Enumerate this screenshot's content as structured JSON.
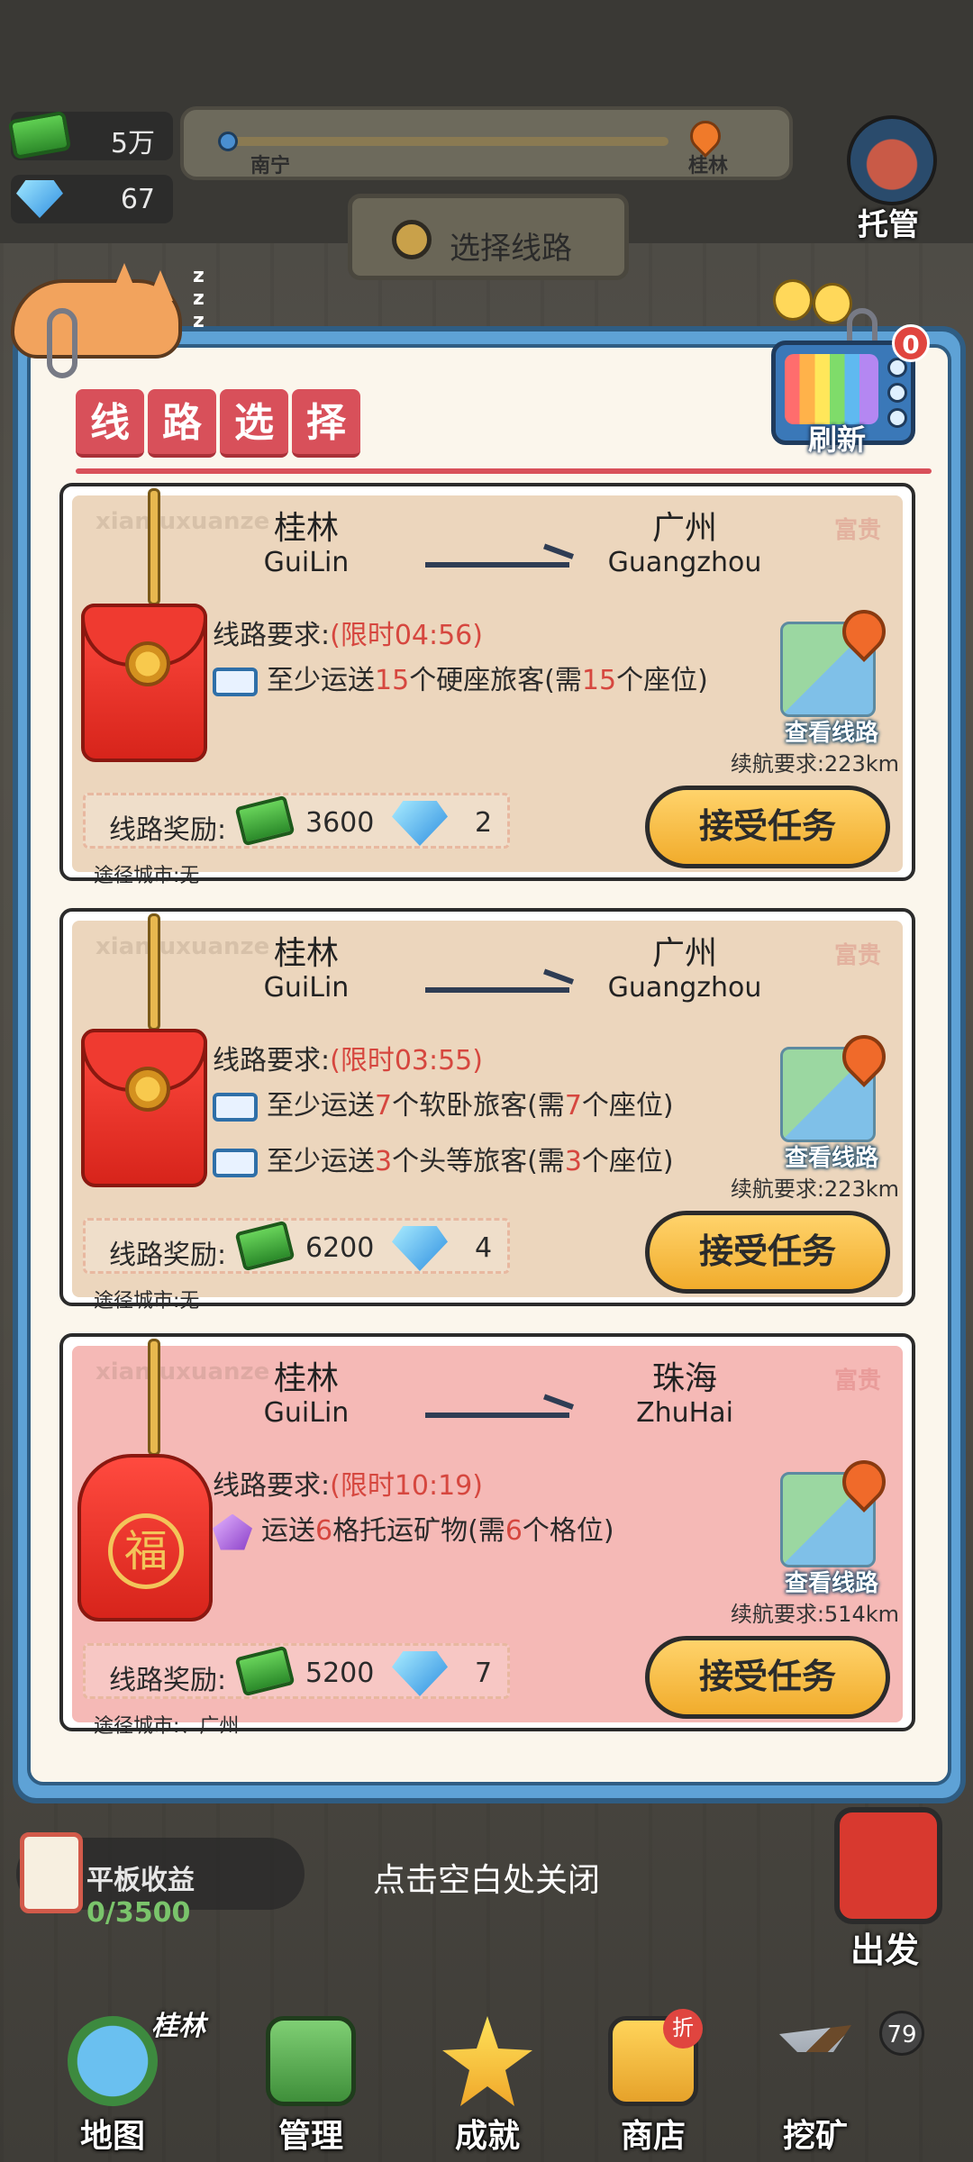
{
  "hud": {
    "money": "5万",
    "gems": "67",
    "route_from": "南宁",
    "route_to": "桂林",
    "select_route_button": "选择线路",
    "autopilot_label": "托管"
  },
  "dialog": {
    "title_chars": [
      "线",
      "路",
      "选",
      "择"
    ],
    "refresh_label": "刷新",
    "refresh_count": "0",
    "watermark": "xianluxuanze",
    "stamp": "富贵"
  },
  "cards": [
    {
      "from_zh": "桂林",
      "from_en": "GuiLin",
      "to_zh": "广州",
      "to_en": "Guangzhou",
      "req_label": "线路要求:",
      "time_limit": "(限时04:56)",
      "requirements": [
        {
          "pre": "至少运送",
          "n1": "15",
          "mid": "个硬座旅客(需",
          "n2": "15",
          "post": "个座位)"
        }
      ],
      "map_button": "查看线路",
      "range": "续航要求:223km",
      "reward_label": "线路奖励:",
      "reward_cash": "3600",
      "reward_gems": "2",
      "via": "途径城市:无",
      "accept": "接受任务"
    },
    {
      "from_zh": "桂林",
      "from_en": "GuiLin",
      "to_zh": "广州",
      "to_en": "Guangzhou",
      "req_label": "线路要求:",
      "time_limit": "(限时03:55)",
      "requirements": [
        {
          "pre": "至少运送",
          "n1": "7",
          "mid": "个软卧旅客(需",
          "n2": "7",
          "post": "个座位)"
        },
        {
          "pre": "至少运送",
          "n1": "3",
          "mid": "个头等旅客(需",
          "n2": "3",
          "post": "个座位)"
        }
      ],
      "map_button": "查看线路",
      "range": "续航要求:223km",
      "reward_label": "线路奖励:",
      "reward_cash": "6200",
      "reward_gems": "4",
      "via": "途径城市:无",
      "accept": "接受任务"
    },
    {
      "from_zh": "桂林",
      "from_en": "GuiLin",
      "to_zh": "珠海",
      "to_en": "ZhuHai",
      "req_label": "线路要求:",
      "time_limit": "(限时10:19)",
      "requirements": [
        {
          "pre": "运送",
          "n1": "6",
          "mid": "格托运矿物(需",
          "n2": "6",
          "post": "个格位)"
        }
      ],
      "map_button": "查看线路",
      "range": "续航要求:514km",
      "reward_label": "线路奖励:",
      "reward_cash": "5200",
      "reward_gems": "7",
      "via": "途径城市:、广州",
      "accept": "接受任务",
      "fu_char": "福"
    }
  ],
  "bottom": {
    "close_hint": "点击空白处关闭",
    "tablet_label": "平板收益",
    "tablet_value": "0/3500",
    "depart_label": "出发",
    "map_city": "桂林",
    "nav": [
      "地图",
      "管理",
      "成就",
      "商店",
      "挖矿"
    ],
    "mine_badge": "79",
    "shop_tag": "折"
  },
  "colors": {
    "dialog_frame": "#5ea2d6",
    "title_red": "#d8505a",
    "accept_yellow": "#f1ac2c",
    "highlight_red": "#d6473f",
    "card_beige": "#ecd6bd",
    "card_pink": "#f5b9b6"
  }
}
